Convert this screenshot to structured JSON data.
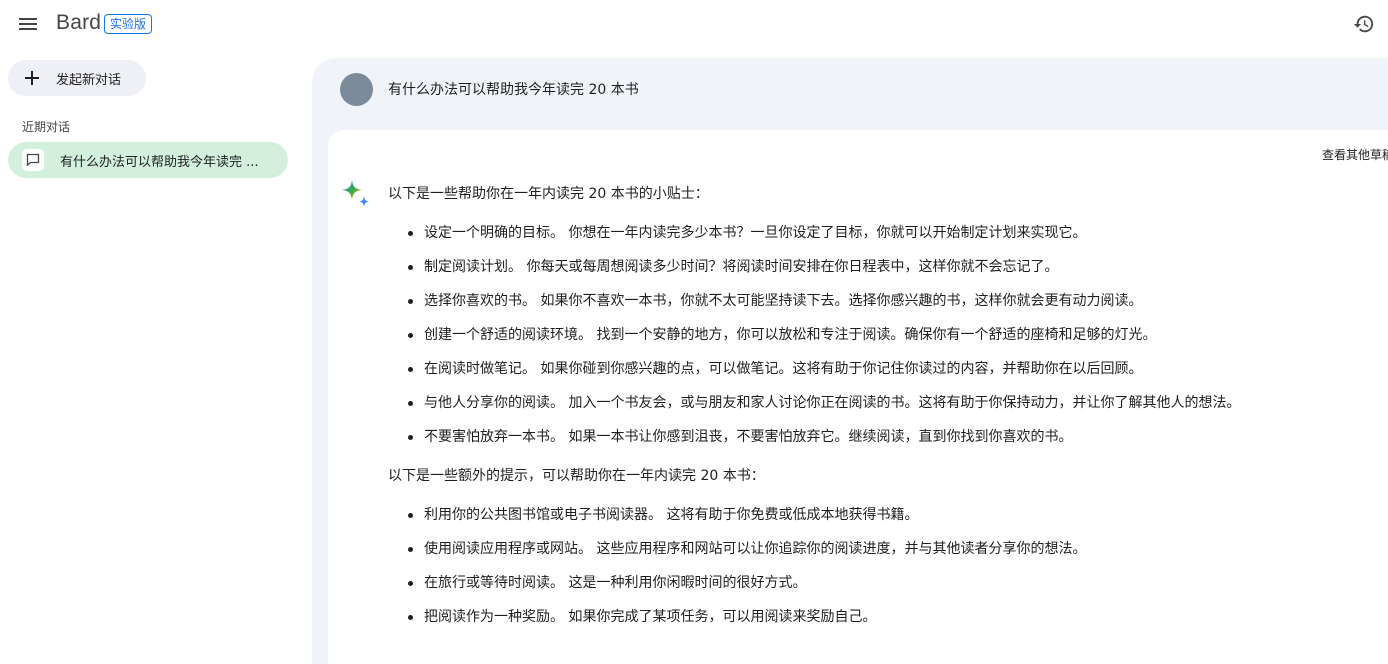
{
  "app": {
    "name": "Bard",
    "badge": "实验版"
  },
  "sidebar": {
    "new_chat_label": "发起新对话",
    "recent_title": "近期对话",
    "chats": [
      {
        "label": "有什么办法可以帮助我今年读完 ..."
      }
    ]
  },
  "conversation": {
    "user_prompt": "有什么办法可以帮助我今年读完 20 本书",
    "other_drafts_label": "查看其他草稿",
    "response": {
      "intro": "以下是一些帮助你在一年内读完 20 本书的小贴士：",
      "tips": [
        "设定一个明确的目标。 你想在一年内读完多少本书？一旦你设定了目标，你就可以开始制定计划来实现它。",
        "制定阅读计划。 你每天或每周想阅读多少时间？将阅读时间安排在你日程表中，这样你就不会忘记了。",
        "选择你喜欢的书。 如果你不喜欢一本书，你就不太可能坚持读下去。选择你感兴趣的书，这样你就会更有动力阅读。",
        "创建一个舒适的阅读环境。 找到一个安静的地方，你可以放松和专注于阅读。确保你有一个舒适的座椅和足够的灯光。",
        "在阅读时做笔记。 如果你碰到你感兴趣的点，可以做笔记。这将有助于你记住你读过的内容，并帮助你在以后回顾。",
        "与他人分享你的阅读。 加入一个书友会，或与朋友和家人讨论你正在阅读的书。这将有助于你保持动力，并让你了解其他人的想法。",
        "不要害怕放弃一本书。 如果一本书让你感到沮丧，不要害怕放弃它。继续阅读，直到你找到你喜欢的书。"
      ],
      "extra_intro": "以下是一些额外的提示，可以帮助你在一年内读完 20 本书：",
      "extra_tips": [
        "利用你的公共图书馆或电子书阅读器。 这将有助于你免费或低成本地获得书籍。",
        "使用阅读应用程序或网站。 这些应用程序和网站可以让你追踪你的阅读进度，并与其他读者分享你的想法。",
        "在旅行或等待时阅读。 这是一种利用你闲暇时间的很好方式。",
        "把阅读作为一种奖励。 如果你完成了某项任务，可以用阅读来奖励自己。"
      ]
    }
  },
  "icons": {
    "menu": "hamburger-menu-icon",
    "history": "history-icon",
    "new_chat": "plus-icon",
    "chat": "chat-bubble-icon",
    "bard": "sparkle-icon"
  },
  "colors": {
    "accent": "#1a73e8",
    "main_bg": "#f0f4f9",
    "active_chat_bg": "#d3f0dd",
    "avatar": "#7b8b99"
  }
}
